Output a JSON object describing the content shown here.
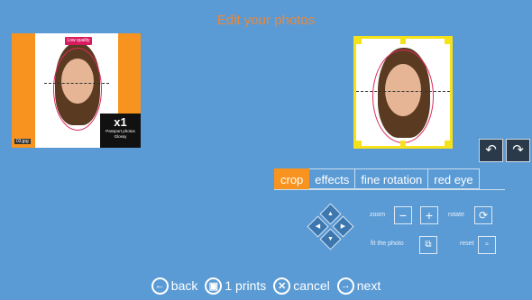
{
  "header": {
    "title": "Edit your photos"
  },
  "thumbnail": {
    "quality_badge": "Low quality",
    "file_name": "03.jpg",
    "quantity": "x1",
    "product": "Passport photos",
    "finish": "Glossy"
  },
  "tabs": [
    {
      "label": "crop",
      "active": true
    },
    {
      "label": "effects",
      "active": false
    },
    {
      "label": "fine rotation",
      "active": false
    },
    {
      "label": "red eye",
      "active": false
    }
  ],
  "controls": {
    "zoom_label": "zoom",
    "zoom_out": "−",
    "zoom_in": "+",
    "rotate_label": "rotate",
    "fit_label": "fit the photo",
    "reset_label": "reset",
    "dpad_icons": {
      "up": "▲",
      "left": "◀",
      "right": "▶",
      "down": "▼"
    }
  },
  "nav": {
    "back": "back",
    "prints": "1 prints",
    "cancel": "cancel",
    "next": "next"
  },
  "colors": {
    "background": "#5b9bd5",
    "accent": "#f7931e",
    "title": "#e8883a",
    "crop_frame": "#f5e21a",
    "warning": "#d81b60"
  }
}
